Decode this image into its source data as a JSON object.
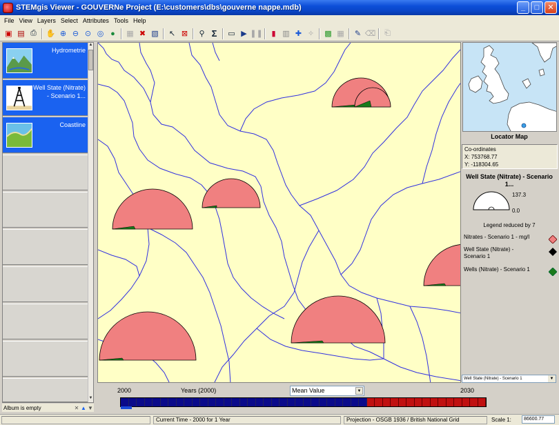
{
  "window": {
    "title": "STEMgis Viewer - GOUVERNe Project (E:\\customers\\dbs\\gouverne nappe.mdb)"
  },
  "menu": {
    "items": [
      "File",
      "View",
      "Layers",
      "Select",
      "Attributes",
      "Tools",
      "Help"
    ]
  },
  "toolbar": {
    "icons": [
      "new-project-icon",
      "open-project-icon",
      "print-icon",
      "pan-hand-icon",
      "zoom-in-icon",
      "zoom-out-icon",
      "zoom-window-icon",
      "zoom-extent-icon",
      "globe-icon",
      "select-layer-icon",
      "delete-layer-icon",
      "properties-icon",
      "select-arrow-icon",
      "clear-selection-icon",
      "query-icon",
      "statistics-sigma-icon",
      "camera-icon",
      "play-icon",
      "pause-icon",
      "chart-icon",
      "chart-2-icon",
      "add-point-icon",
      "remove-point-icon",
      "color-ramp-icon",
      "grid-icon",
      "draw-pen-icon",
      "eraser-icon",
      "export-icon"
    ]
  },
  "album": {
    "items": [
      {
        "label": "Hydrometrie",
        "active": true
      },
      {
        "label": "Well State (Nitrate) - Scenario 1...",
        "active": true
      },
      {
        "label": "Coastline",
        "active": true
      }
    ],
    "status": "Album is empty"
  },
  "locator": {
    "title": "Locator Map",
    "coords_label": "Co-ordinates",
    "x": "X: 753768.77",
    "y": "Y: -118304.65"
  },
  "legend": {
    "title": "Well State (Nitrate) - Scenario 1...",
    "gauge_max": "137.3",
    "gauge_min": "0.0",
    "reduced": "Legend reduced by 7",
    "entries": [
      {
        "label": "Nitrates - Scenario 1 - mg/l",
        "color": "#f08080"
      },
      {
        "label": "Well State (Nitrate) - Scenario 1",
        "color": "#000000"
      },
      {
        "label": "Wells (Nitrate) - Scenario 1",
        "color": "#1a7a1a"
      }
    ],
    "layer_select": "Well State (Nitrate) - Scenario 1"
  },
  "timebar": {
    "start": "2000",
    "label": "Years (2000)",
    "end": "2030",
    "mode": "Mean Value",
    "past_cells": 31,
    "future_cells": 15
  },
  "status": {
    "current_time": "Current Time - 2000 for 1 Year",
    "projection": "Projection - OSGB 1936 / British National Grid",
    "scale_label": "Scale 1:",
    "scale_value": "86600.77"
  },
  "colors": {
    "map_bg": "#ffffc6",
    "river": "#3030e0",
    "glyph_fill": "#f08080",
    "glyph_base": "#1a7a1a",
    "album_active": "#1a62f0"
  }
}
